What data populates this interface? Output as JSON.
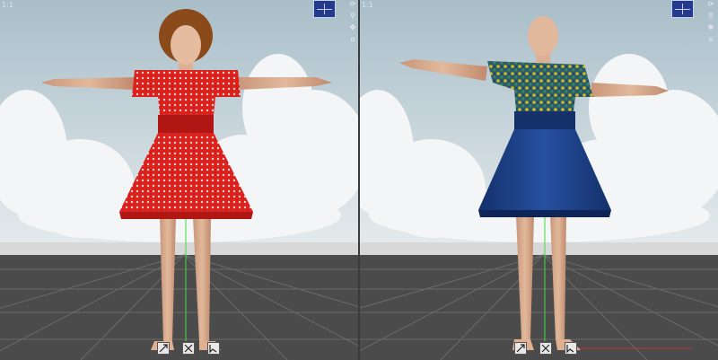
{
  "viewports": {
    "left": {
      "label": "1:1"
    },
    "right": {
      "label": "1:1"
    }
  },
  "colors": {
    "sky_top": "#a9bec9",
    "sky_bottom": "#dfe7ea",
    "cloud": "#f2f4f5",
    "floor": "#4b4b4b",
    "grid": "#6a6a6a",
    "skin": "#dbb093",
    "red_dress": "#d9221e",
    "red_band": "#b01614",
    "blue_dress": "#1c3f88",
    "blue_band": "#14306a",
    "pattern_top": "#2a5c6a",
    "hair": "#8a4a1a",
    "axis_green": "#3fdc3f",
    "axis_red": "#c93030"
  },
  "icons": {
    "camera_cube": "camera-cube-icon",
    "nav": [
      "rotate-icon",
      "zoom-icon",
      "pan-icon",
      "home-icon"
    ],
    "tools": [
      "scale-icon",
      "reset-icon",
      "select-icon"
    ]
  }
}
